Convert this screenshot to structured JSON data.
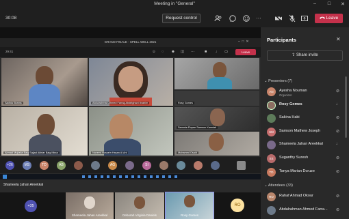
{
  "window": {
    "title": "Meeting in \"General\""
  },
  "toolbar": {
    "timer": "30:08",
    "request_control": "Request control",
    "leave": "Leave",
    "icons": [
      "people-icon",
      "chat-icon",
      "reactions-icon",
      "more-icon",
      "camera-off-icon",
      "mic-off-icon",
      "share-tray-icon"
    ]
  },
  "shared": {
    "title": "GRAND FINALE - SPELL WELL 2021",
    "time": "29:41",
    "leave": "Leave",
    "tiles": [
      {
        "name": "Sadhia Shams"
      },
      {
        "name": "Abdulrahman Ahmed Farrag Abdelghani Ibrahim"
      },
      {
        "name": ""
      },
      {
        "name": "Rosy Gomes"
      },
      {
        "name": "Ahmad Mujtaba Baig Sajjad Akhtar Baig Mirza"
      },
      {
        "name": "Naveed Hussein Hasan Al Ani"
      },
      {
        "name": "Sammie Rupee Samson Kanniah"
      },
      {
        "name": "Mohamed Osaid"
      }
    ],
    "roster": [
      "+26",
      "MS",
      "TD",
      "AB",
      "",
      "",
      "AG",
      "",
      "SI",
      "",
      "",
      "",
      "",
      ""
    ],
    "presenter": "Shameela Jahan Areekkal"
  },
  "bottom": {
    "more": "+35",
    "tiles": [
      {
        "name": "Shameela Jahan Areekkal"
      },
      {
        "name": "Deborah Virginia Daniels"
      },
      {
        "name": "Rosy Gomes"
      }
    ],
    "initials": "RO"
  },
  "panel": {
    "title": "Participants",
    "share_invite": "Share invite",
    "presenters_label": "Presenters (7)",
    "attendees_label": "Attendees (33)",
    "presenters": [
      {
        "initials": "AN",
        "name": "Ayesha Nouman",
        "sub": "Organizer",
        "color": "#c9856b"
      },
      {
        "initials": "",
        "name": "Rosy Gomes",
        "sub": "",
        "color": "#8c6e62"
      },
      {
        "initials": "",
        "name": "Sakina Habi",
        "sub": "",
        "color": "#5d7b5a"
      },
      {
        "initials": "SM",
        "name": "Samson Mathew Joseph",
        "sub": "",
        "color": "#c76e6e"
      },
      {
        "initials": "",
        "name": "Shameela Jahan Areekkal",
        "sub": "",
        "color": "#7a6a8a"
      },
      {
        "initials": "SS",
        "name": "Suganthy Suresh",
        "sub": "",
        "color": "#b86a6a"
      },
      {
        "initials": "TD",
        "name": "Tanya Marian Dcruze",
        "sub": "",
        "color": "#c97a5f"
      }
    ],
    "attendees": [
      {
        "initials": "RO",
        "name": "Rahaf Ahmad Okour",
        "sub": "",
        "color": "#b8866c"
      },
      {
        "initials": "",
        "name": "Abdalrahman Ahmed Farra...",
        "sub": "",
        "color": "#6d7a8a"
      }
    ]
  }
}
